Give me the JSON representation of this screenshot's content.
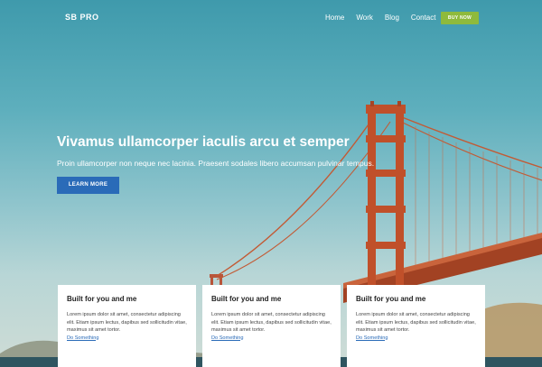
{
  "nav": {
    "brand": "SB PRO",
    "links": [
      "Home",
      "Work",
      "Blog",
      "Contact"
    ],
    "cta": "BUY NOW"
  },
  "hero": {
    "title": "Vivamus ullamcorper iaculis arcu et semper",
    "subtitle": "Proin ullamcorper non neque nec lacinia. Praesent sodales libero accumsan pulvinar tempus.",
    "button": "LEARN MORE"
  },
  "cards": [
    {
      "title": "Built for you and me",
      "body": "Lorem ipsum dolor sit amet, consectetur adipiscing elit. Etiam ipsum lectus, dapibus sed sollicitudin vitae, maximus sit amet tortor.",
      "link": "Do Something"
    },
    {
      "title": "Built for you and me",
      "body": "Lorem ipsum dolor sit amet, consectetur adipiscing elit. Etiam ipsum lectus, dapibus sed sollicitudin vitae, maximus sit amet tortor.",
      "link": "Do Something"
    },
    {
      "title": "Built for you and me",
      "body": "Lorem ipsum dolor sit amet, consectetur adipiscing elit. Etiam ipsum lectus, dapibus sed sollicitudin vitae, maximus sit amet tortor.",
      "link": "Do Something"
    }
  ],
  "colors": {
    "accent_green": "#8fba3c",
    "primary_blue": "#2a6bb8",
    "bridge_orange": "#c0502a"
  }
}
